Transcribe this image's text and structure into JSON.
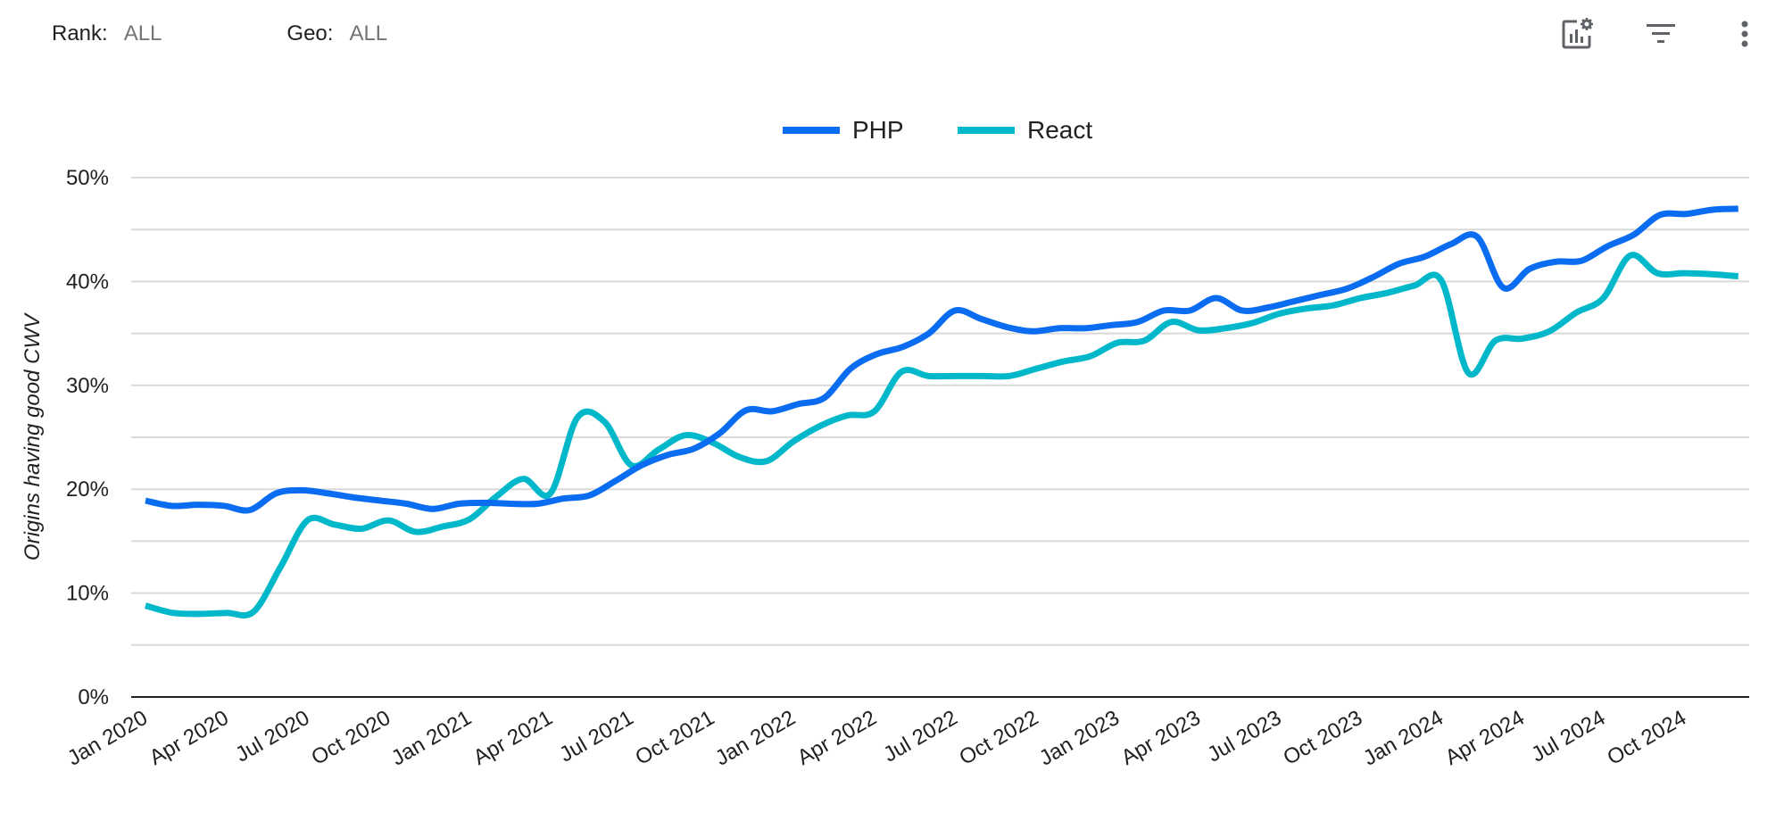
{
  "filters": [
    {
      "label": "Rank:",
      "value": "ALL"
    },
    {
      "label": "Geo:",
      "value": "ALL"
    }
  ],
  "toolbar": {
    "icons": [
      "chart-settings-icon",
      "filter-icon",
      "more-vert-icon"
    ]
  },
  "chart_data": {
    "type": "line",
    "title": "",
    "xlabel": "",
    "ylabel": "Origins having good CWV",
    "ylim": [
      0,
      50
    ],
    "yticks": [
      "0%",
      "10%",
      "20%",
      "30%",
      "40%",
      "50%"
    ],
    "y_minor_step": 5,
    "grid": true,
    "legend_position": "top-center",
    "x_tick_labels": [
      "Jan 2020",
      "Apr 2020",
      "Jul 2020",
      "Oct 2020",
      "Jan 2021",
      "Apr 2021",
      "Jul 2021",
      "Oct 2021",
      "Jan 2022",
      "Apr 2022",
      "Jul 2022",
      "Oct 2022",
      "Jan 2023",
      "Apr 2023",
      "Jul 2023",
      "Oct 2023",
      "Jan 2024",
      "Apr 2024",
      "Jul 2024",
      "Oct 2024"
    ],
    "x": [
      "Jan 2020",
      "Feb 2020",
      "Mar 2020",
      "Apr 2020",
      "May 2020",
      "Jun 2020",
      "Jul 2020",
      "Aug 2020",
      "Sep 2020",
      "Oct 2020",
      "Nov 2020",
      "Dec 2020",
      "Jan 2021",
      "Feb 2021",
      "Mar 2021",
      "Apr 2021",
      "May 2021",
      "Jun 2021",
      "Jul 2021",
      "Aug 2021",
      "Sep 2021",
      "Oct 2021",
      "Nov 2021",
      "Dec 2021",
      "Jan 2022",
      "Feb 2022",
      "Mar 2022",
      "Apr 2022",
      "May 2022",
      "Jun 2022",
      "Jul 2022",
      "Aug 2022",
      "Sep 2022",
      "Oct 2022",
      "Nov 2022",
      "Dec 2022",
      "Jan 2023",
      "Feb 2023",
      "Mar 2023",
      "Apr 2023",
      "May 2023",
      "Jun 2023",
      "Jul 2023",
      "Aug 2023",
      "Sep 2023",
      "Oct 2023",
      "Nov 2023",
      "Dec 2023",
      "Jan 2024",
      "Feb 2024",
      "Mar 2024",
      "Apr 2024",
      "May 2024",
      "Jun 2024",
      "Jul 2024",
      "Aug 2024",
      "Sep 2024",
      "Oct 2024",
      "Nov 2024",
      "Dec 2024"
    ],
    "series": [
      {
        "name": "PHP",
        "color": "#0a6cf0",
        "values": [
          18.9,
          18.4,
          18.5,
          18.4,
          18.0,
          19.6,
          19.9,
          19.6,
          19.2,
          18.9,
          18.6,
          18.1,
          18.6,
          18.7,
          18.6,
          18.6,
          19.1,
          19.4,
          20.8,
          22.3,
          23.3,
          23.9,
          25.4,
          27.6,
          27.5,
          28.2,
          28.8,
          31.6,
          33.0,
          33.7,
          35.0,
          37.2,
          36.4,
          35.6,
          35.2,
          35.5,
          35.5,
          35.8,
          36.1,
          37.2,
          37.2,
          38.4,
          37.2,
          37.5,
          38.1,
          38.7,
          39.3,
          40.4,
          41.7,
          42.4,
          43.6,
          44.3,
          39.4,
          41.2,
          41.9,
          42.0,
          43.4,
          44.5,
          46.4,
          46.5,
          46.9,
          47.0
        ]
      },
      {
        "name": "React",
        "color": "#00b8c9",
        "values": [
          8.8,
          8.1,
          8.0,
          8.1,
          8.2,
          12.5,
          17.0,
          16.6,
          16.2,
          17.0,
          15.9,
          16.4,
          17.1,
          19.3,
          21.0,
          19.6,
          26.9,
          26.5,
          22.3,
          23.8,
          25.2,
          24.5,
          23.1,
          22.7,
          24.6,
          26.1,
          27.1,
          27.5,
          31.3,
          30.9,
          30.9,
          30.9,
          30.9,
          31.6,
          32.3,
          32.8,
          34.1,
          34.3,
          36.1,
          35.3,
          35.5,
          36.0,
          36.9,
          37.4,
          37.7,
          38.4,
          38.9,
          39.6,
          40.1,
          31.2,
          34.3,
          34.5,
          35.2,
          37.0,
          38.4,
          42.5,
          40.8,
          40.8,
          40.7,
          40.5
        ]
      }
    ]
  }
}
